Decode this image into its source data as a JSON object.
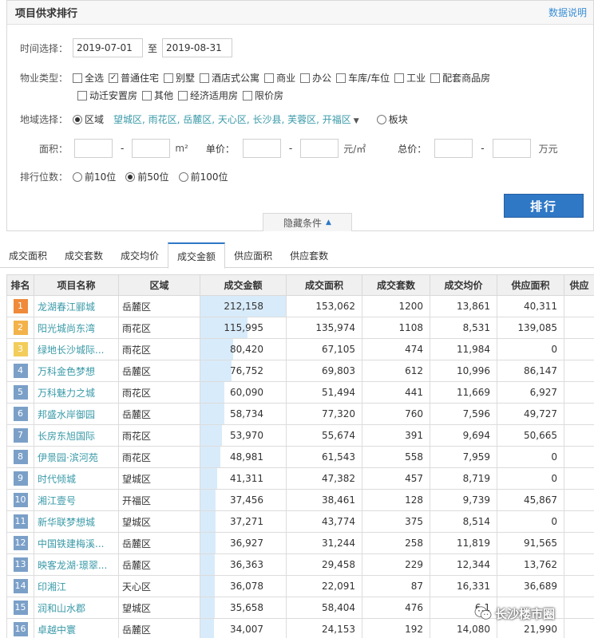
{
  "panel": {
    "title": "项目供求排行",
    "help_link": "数据说明"
  },
  "time": {
    "label": "时间选择：",
    "from": "2019-07-01",
    "sep": "至",
    "to": "2019-08-31"
  },
  "property_type": {
    "label": "物业类型：",
    "options": [
      {
        "label": "全选",
        "checked": false
      },
      {
        "label": "普通住宅",
        "checked": true
      },
      {
        "label": "别墅",
        "checked": false
      },
      {
        "label": "酒店式公寓",
        "checked": false
      },
      {
        "label": "商业",
        "checked": false
      },
      {
        "label": "办公",
        "checked": false
      },
      {
        "label": "车库/车位",
        "checked": false
      },
      {
        "label": "工业",
        "checked": false
      },
      {
        "label": "配套商品房",
        "checked": false
      },
      {
        "label": "动迁安置房",
        "checked": false
      },
      {
        "label": "其他",
        "checked": false
      },
      {
        "label": "经济适用房",
        "checked": false
      },
      {
        "label": "限价房",
        "checked": false
      }
    ]
  },
  "region": {
    "label": "地域选择：",
    "opt_area": "区域",
    "areas": "望城区, 雨花区, 岳麓区, 天心区, 长沙县, 芙蓉区, 开福区",
    "opt_block": "板块"
  },
  "filters": {
    "area_label": "面积：",
    "area_unit": "m²",
    "price_label": "单价：",
    "price_unit": "元/㎡",
    "total_label": "总价：",
    "total_unit": "万元",
    "dash": "-"
  },
  "ranking": {
    "label": "排行位数：",
    "options": [
      {
        "label": "前10位",
        "selected": false
      },
      {
        "label": "前50位",
        "selected": true
      },
      {
        "label": "前100位",
        "selected": false
      }
    ]
  },
  "buttons": {
    "rank": "排行",
    "hide": "隐藏条件"
  },
  "tabs": [
    {
      "label": "成交面积",
      "active": false
    },
    {
      "label": "成交套数",
      "active": false
    },
    {
      "label": "成交均价",
      "active": false
    },
    {
      "label": "成交金额",
      "active": true
    },
    {
      "label": "供应面积",
      "active": false
    },
    {
      "label": "供应套数",
      "active": false
    }
  ],
  "table": {
    "headers": [
      "排名",
      "项目名称",
      "区域",
      "成交金额",
      "成交面积",
      "成交套数",
      "成交均价",
      "供应面积",
      "供应"
    ],
    "rows": [
      {
        "rank": "1",
        "name": "龙湖春江郦城",
        "district": "岳麓区",
        "amount": "212,158",
        "amount_value": 212158,
        "area": "153,062",
        "units": "1200",
        "avg": "13,861",
        "supply": "40,311"
      },
      {
        "rank": "2",
        "name": "阳光城尚东湾",
        "district": "雨花区",
        "amount": "115,995",
        "amount_value": 115995,
        "area": "135,974",
        "units": "1108",
        "avg": "8,531",
        "supply": "139,085"
      },
      {
        "rank": "3",
        "name": "绿地长沙城际...",
        "district": "雨花区",
        "amount": "80,420",
        "amount_value": 80420,
        "area": "67,105",
        "units": "474",
        "avg": "11,984",
        "supply": "0"
      },
      {
        "rank": "4",
        "name": "万科金色梦想",
        "district": "岳麓区",
        "amount": "76,752",
        "amount_value": 76752,
        "area": "69,803",
        "units": "612",
        "avg": "10,996",
        "supply": "86,147"
      },
      {
        "rank": "5",
        "name": "万科魅力之城",
        "district": "雨花区",
        "amount": "60,090",
        "amount_value": 60090,
        "area": "51,494",
        "units": "441",
        "avg": "11,669",
        "supply": "6,927"
      },
      {
        "rank": "6",
        "name": "邦盛水岸御园",
        "district": "岳麓区",
        "amount": "58,734",
        "amount_value": 58734,
        "area": "77,320",
        "units": "760",
        "avg": "7,596",
        "supply": "49,727"
      },
      {
        "rank": "7",
        "name": "长房东旭国际",
        "district": "雨花区",
        "amount": "53,970",
        "amount_value": 53970,
        "area": "55,674",
        "units": "391",
        "avg": "9,694",
        "supply": "50,665"
      },
      {
        "rank": "8",
        "name": "伊景园·滨河苑",
        "district": "雨花区",
        "amount": "48,981",
        "amount_value": 48981,
        "area": "61,543",
        "units": "558",
        "avg": "7,959",
        "supply": "0"
      },
      {
        "rank": "9",
        "name": "时代倾城",
        "district": "望城区",
        "amount": "41,311",
        "amount_value": 41311,
        "area": "47,382",
        "units": "457",
        "avg": "8,719",
        "supply": "0"
      },
      {
        "rank": "10",
        "name": "湘江壹号",
        "district": "开福区",
        "amount": "37,456",
        "amount_value": 37456,
        "area": "38,461",
        "units": "128",
        "avg": "9,739",
        "supply": "45,867"
      },
      {
        "rank": "11",
        "name": "新华联梦想城",
        "district": "望城区",
        "amount": "37,271",
        "amount_value": 37271,
        "area": "43,774",
        "units": "375",
        "avg": "8,514",
        "supply": "0"
      },
      {
        "rank": "12",
        "name": "中国铁建梅溪...",
        "district": "岳麓区",
        "amount": "36,927",
        "amount_value": 36927,
        "area": "31,244",
        "units": "258",
        "avg": "11,819",
        "supply": "91,565"
      },
      {
        "rank": "13",
        "name": "映客龙湖·璟翠...",
        "district": "岳麓区",
        "amount": "36,363",
        "amount_value": 36363,
        "area": "29,458",
        "units": "229",
        "avg": "12,344",
        "supply": "13,762"
      },
      {
        "rank": "14",
        "name": "印湘江",
        "district": "天心区",
        "amount": "36,078",
        "amount_value": 36078,
        "area": "22,091",
        "units": "87",
        "avg": "16,331",
        "supply": "36,689"
      },
      {
        "rank": "15",
        "name": "润和山水郡",
        "district": "望城区",
        "amount": "35,658",
        "amount_value": 35658,
        "area": "58,404",
        "units": "476",
        "avg": "6,1",
        "supply": ""
      },
      {
        "rank": "16",
        "name": "卓越中寰",
        "district": "岳麓区",
        "amount": "34,007",
        "amount_value": 34007,
        "area": "24,153",
        "units": "192",
        "avg": "14,080",
        "supply": "21,990"
      }
    ]
  },
  "watermark": {
    "text": "长沙楼市圈",
    "icon": "wechat-logo-icon"
  }
}
